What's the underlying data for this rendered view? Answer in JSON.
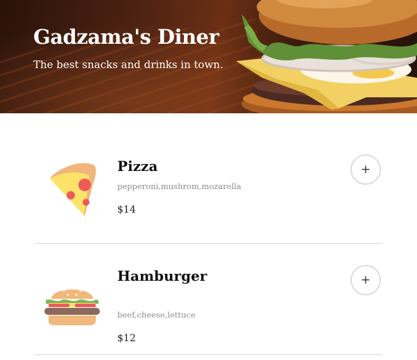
{
  "header": {
    "title": "Gadzama's Diner",
    "subtitle": "The best snacks and drinks in town."
  },
  "menu": {
    "items": [
      {
        "name": "Pizza",
        "description": "pepperoni,mushrom,mozarella",
        "price": "$14",
        "icon": "pizza-slice-icon",
        "add_label": "+"
      },
      {
        "name": "Hamburger",
        "description": "beef,cheese,lettuce",
        "price": "$12",
        "icon": "hamburger-icon",
        "add_label": "+"
      }
    ]
  },
  "colors": {
    "pizza_crust": "#f2b57c",
    "pizza_cheese": "#fde26a",
    "pepperoni": "#ee5a5a",
    "bun": "#f0b87b",
    "lettuce": "#7fb55a",
    "patty": "#8b6a5c",
    "divider": "#d6d6d6"
  }
}
